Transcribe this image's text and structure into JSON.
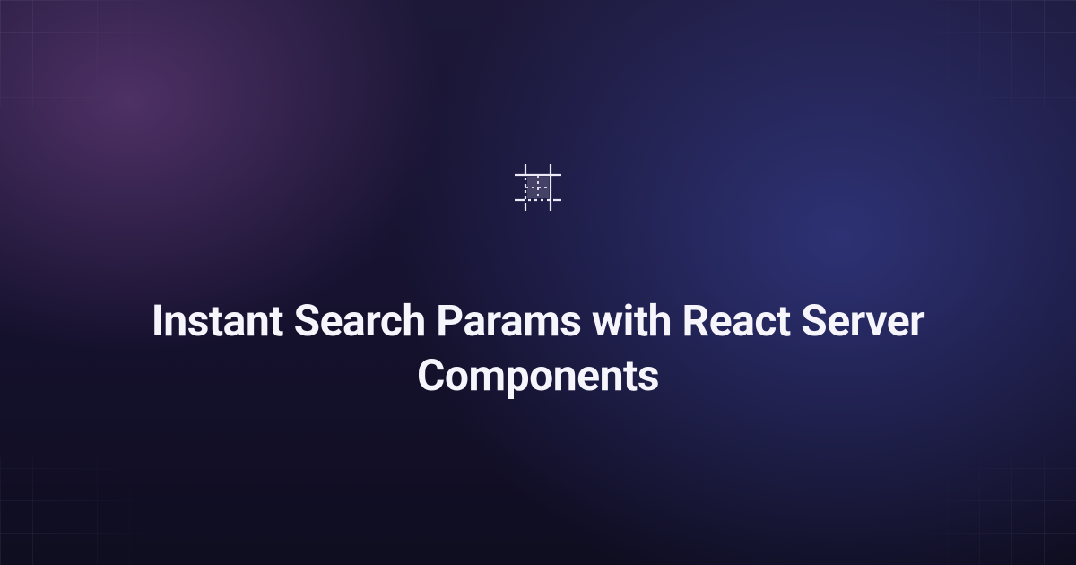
{
  "card": {
    "title": "Instant Search Params with React Server Components",
    "logo_name": "buildui-logo-icon"
  }
}
